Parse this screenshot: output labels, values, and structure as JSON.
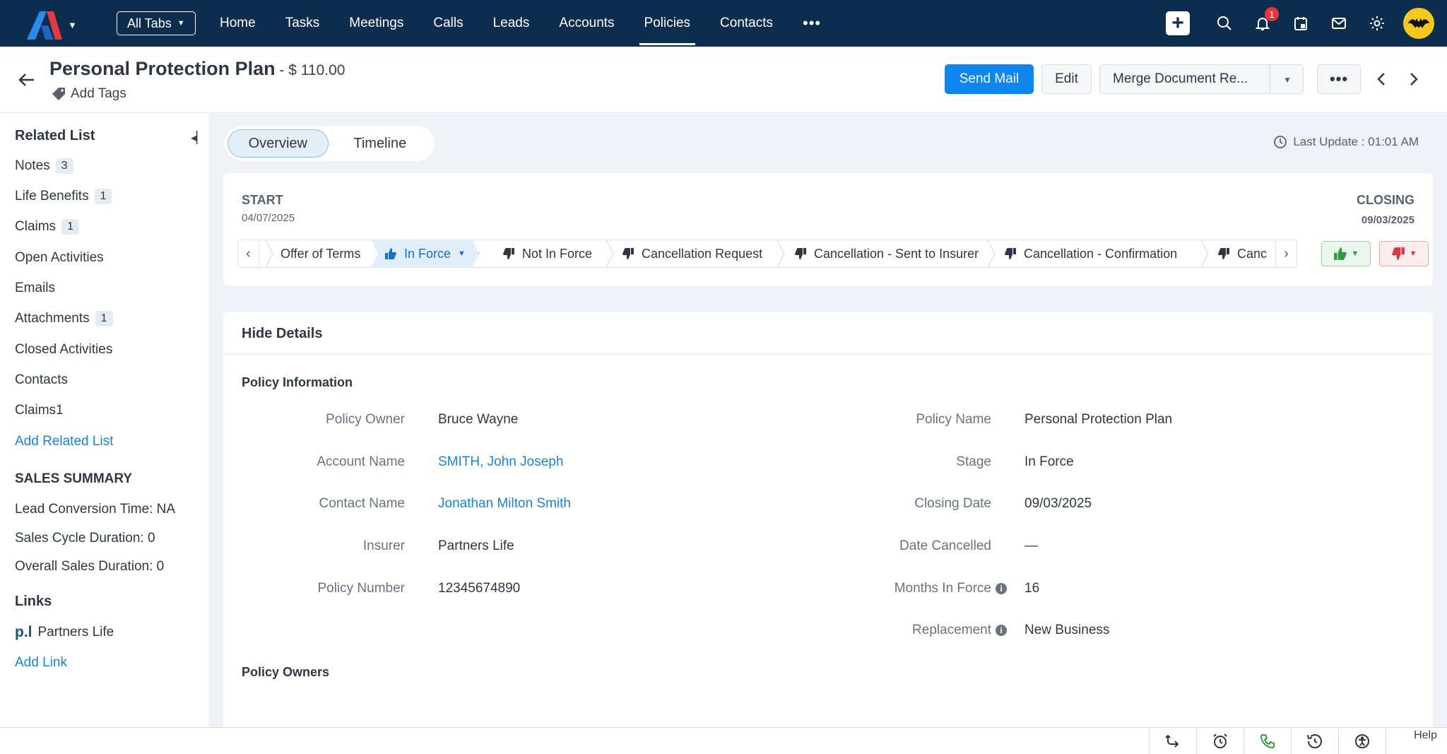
{
  "nav": {
    "alltabs_label": "All Tabs",
    "links": [
      "Home",
      "Tasks",
      "Meetings",
      "Calls",
      "Leads",
      "Accounts",
      "Policies",
      "Contacts"
    ],
    "active": "Policies",
    "more": "•••",
    "notification_count": "1"
  },
  "record": {
    "title": "Personal Protection Plan",
    "amount": " - $ 110.00",
    "add_tags": "Add Tags",
    "send_mail": "Send Mail",
    "edit": "Edit",
    "merge": "Merge Document Re...",
    "more": "•••"
  },
  "sidebar": {
    "related_list_title": "Related List",
    "related": [
      {
        "label": "Notes",
        "count": "3"
      },
      {
        "label": "Life Benefits",
        "count": "1"
      },
      {
        "label": "Claims",
        "count": "1"
      },
      {
        "label": "Open Activities",
        "count": ""
      },
      {
        "label": "Emails",
        "count": ""
      },
      {
        "label": "Attachments",
        "count": "1"
      },
      {
        "label": "Closed Activities",
        "count": ""
      },
      {
        "label": "Contacts",
        "count": ""
      },
      {
        "label": "Claims1",
        "count": ""
      }
    ],
    "add_related_list": "Add Related List",
    "sales_summary_title": "SALES SUMMARY",
    "sales_summary": [
      "Lead Conversion Time: NA",
      "Sales Cycle Duration: 0",
      "Overall Sales Duration: 0"
    ],
    "links_title": "Links",
    "link_logo": "p.l",
    "link_name": "Partners Life",
    "add_link": "Add Link"
  },
  "tabs": {
    "overview": "Overview",
    "timeline": "Timeline"
  },
  "last_update": "Last Update : 01:01 AM",
  "stage": {
    "start_label": "START",
    "start_date": "04/07/2025",
    "closing_label": "CLOSING",
    "closing_date": "09/03/2025",
    "stages": [
      "Offer of Terms",
      "In Force",
      "Not In Force",
      "Cancellation Request",
      "Cancellation - Sent to Insurer",
      "Cancellation - Confirmation",
      "Canc"
    ]
  },
  "details": {
    "hide_details": "Hide Details",
    "policy_information": "Policy Information",
    "policy_owners": "Policy Owners",
    "left": [
      {
        "label": "Policy Owner",
        "value": "Bruce Wayne",
        "link": false
      },
      {
        "label": "Account Name",
        "value": "SMITH, John Joseph",
        "link": true
      },
      {
        "label": "Contact Name",
        "value": "Jonathan Milton Smith",
        "link": true
      },
      {
        "label": "Insurer",
        "value": "Partners Life",
        "link": false
      },
      {
        "label": "Policy Number",
        "value": "12345674890",
        "link": false
      }
    ],
    "right": [
      {
        "label": "Policy Name",
        "value": "Personal Protection Plan"
      },
      {
        "label": "Stage",
        "value": "In Force"
      },
      {
        "label": "Closing Date",
        "value": "09/03/2025"
      },
      {
        "label": "Date Cancelled",
        "value": "—"
      },
      {
        "label": "Months In Force",
        "value": "16"
      },
      {
        "label": "Replacement",
        "value": "New Business"
      }
    ]
  },
  "bottom": {
    "help": "Help"
  }
}
